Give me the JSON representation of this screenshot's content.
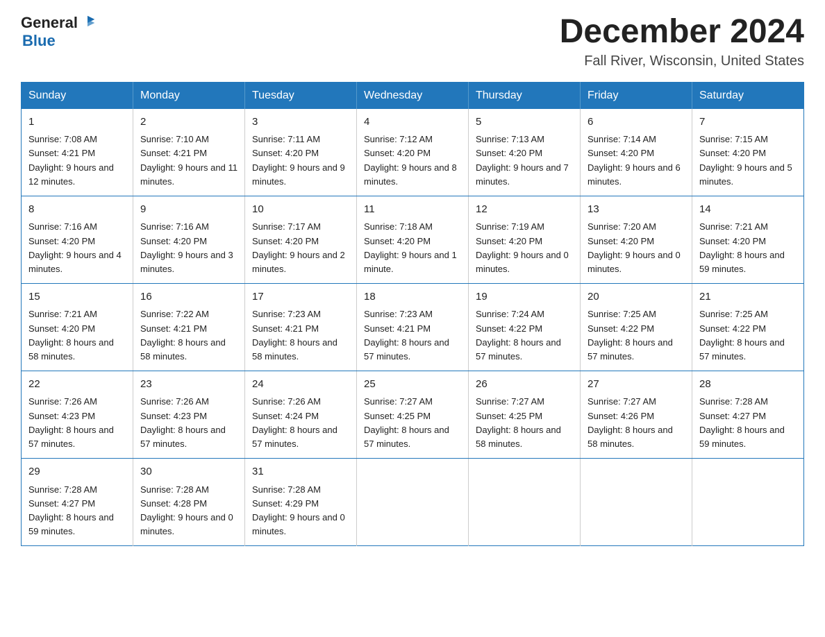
{
  "header": {
    "logo_general": "General",
    "logo_blue": "Blue",
    "month_title": "December 2024",
    "location": "Fall River, Wisconsin, United States"
  },
  "weekdays": [
    "Sunday",
    "Monday",
    "Tuesday",
    "Wednesday",
    "Thursday",
    "Friday",
    "Saturday"
  ],
  "weeks": [
    [
      {
        "day": "1",
        "sunrise": "7:08 AM",
        "sunset": "4:21 PM",
        "daylight": "9 hours and 12 minutes."
      },
      {
        "day": "2",
        "sunrise": "7:10 AM",
        "sunset": "4:21 PM",
        "daylight": "9 hours and 11 minutes."
      },
      {
        "day": "3",
        "sunrise": "7:11 AM",
        "sunset": "4:20 PM",
        "daylight": "9 hours and 9 minutes."
      },
      {
        "day": "4",
        "sunrise": "7:12 AM",
        "sunset": "4:20 PM",
        "daylight": "9 hours and 8 minutes."
      },
      {
        "day": "5",
        "sunrise": "7:13 AM",
        "sunset": "4:20 PM",
        "daylight": "9 hours and 7 minutes."
      },
      {
        "day": "6",
        "sunrise": "7:14 AM",
        "sunset": "4:20 PM",
        "daylight": "9 hours and 6 minutes."
      },
      {
        "day": "7",
        "sunrise": "7:15 AM",
        "sunset": "4:20 PM",
        "daylight": "9 hours and 5 minutes."
      }
    ],
    [
      {
        "day": "8",
        "sunrise": "7:16 AM",
        "sunset": "4:20 PM",
        "daylight": "9 hours and 4 minutes."
      },
      {
        "day": "9",
        "sunrise": "7:16 AM",
        "sunset": "4:20 PM",
        "daylight": "9 hours and 3 minutes."
      },
      {
        "day": "10",
        "sunrise": "7:17 AM",
        "sunset": "4:20 PM",
        "daylight": "9 hours and 2 minutes."
      },
      {
        "day": "11",
        "sunrise": "7:18 AM",
        "sunset": "4:20 PM",
        "daylight": "9 hours and 1 minute."
      },
      {
        "day": "12",
        "sunrise": "7:19 AM",
        "sunset": "4:20 PM",
        "daylight": "9 hours and 0 minutes."
      },
      {
        "day": "13",
        "sunrise": "7:20 AM",
        "sunset": "4:20 PM",
        "daylight": "9 hours and 0 minutes."
      },
      {
        "day": "14",
        "sunrise": "7:21 AM",
        "sunset": "4:20 PM",
        "daylight": "8 hours and 59 minutes."
      }
    ],
    [
      {
        "day": "15",
        "sunrise": "7:21 AM",
        "sunset": "4:20 PM",
        "daylight": "8 hours and 58 minutes."
      },
      {
        "day": "16",
        "sunrise": "7:22 AM",
        "sunset": "4:21 PM",
        "daylight": "8 hours and 58 minutes."
      },
      {
        "day": "17",
        "sunrise": "7:23 AM",
        "sunset": "4:21 PM",
        "daylight": "8 hours and 58 minutes."
      },
      {
        "day": "18",
        "sunrise": "7:23 AM",
        "sunset": "4:21 PM",
        "daylight": "8 hours and 57 minutes."
      },
      {
        "day": "19",
        "sunrise": "7:24 AM",
        "sunset": "4:22 PM",
        "daylight": "8 hours and 57 minutes."
      },
      {
        "day": "20",
        "sunrise": "7:25 AM",
        "sunset": "4:22 PM",
        "daylight": "8 hours and 57 minutes."
      },
      {
        "day": "21",
        "sunrise": "7:25 AM",
        "sunset": "4:22 PM",
        "daylight": "8 hours and 57 minutes."
      }
    ],
    [
      {
        "day": "22",
        "sunrise": "7:26 AM",
        "sunset": "4:23 PM",
        "daylight": "8 hours and 57 minutes."
      },
      {
        "day": "23",
        "sunrise": "7:26 AM",
        "sunset": "4:23 PM",
        "daylight": "8 hours and 57 minutes."
      },
      {
        "day": "24",
        "sunrise": "7:26 AM",
        "sunset": "4:24 PM",
        "daylight": "8 hours and 57 minutes."
      },
      {
        "day": "25",
        "sunrise": "7:27 AM",
        "sunset": "4:25 PM",
        "daylight": "8 hours and 57 minutes."
      },
      {
        "day": "26",
        "sunrise": "7:27 AM",
        "sunset": "4:25 PM",
        "daylight": "8 hours and 58 minutes."
      },
      {
        "day": "27",
        "sunrise": "7:27 AM",
        "sunset": "4:26 PM",
        "daylight": "8 hours and 58 minutes."
      },
      {
        "day": "28",
        "sunrise": "7:28 AM",
        "sunset": "4:27 PM",
        "daylight": "8 hours and 59 minutes."
      }
    ],
    [
      {
        "day": "29",
        "sunrise": "7:28 AM",
        "sunset": "4:27 PM",
        "daylight": "8 hours and 59 minutes."
      },
      {
        "day": "30",
        "sunrise": "7:28 AM",
        "sunset": "4:28 PM",
        "daylight": "9 hours and 0 minutes."
      },
      {
        "day": "31",
        "sunrise": "7:28 AM",
        "sunset": "4:29 PM",
        "daylight": "9 hours and 0 minutes."
      },
      null,
      null,
      null,
      null
    ]
  ]
}
